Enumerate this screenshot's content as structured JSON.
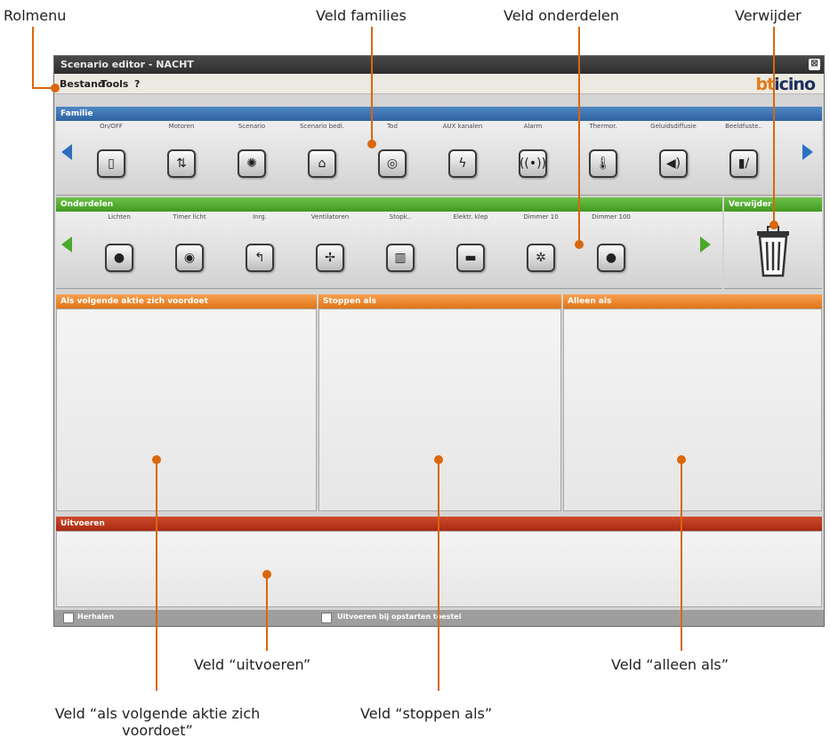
{
  "callouts": {
    "rolmenu": "Rolmenu",
    "veld_families": "Veld families",
    "veld_onderdelen": "Veld onderdelen",
    "verwijder": "Verwijder",
    "veld_uitvoeren": "Veld “uitvoeren”",
    "veld_alleen_als": "Veld “alleen als”",
    "veld_als_volgende": "Veld “als volgende aktie zich voordoet”",
    "veld_stoppen_als": "Veld “stoppen als”"
  },
  "window": {
    "title": "Scenario editor - NACHT",
    "close_glyph": "⊠"
  },
  "menu": {
    "items": [
      "Bestand",
      "Tools",
      "?"
    ]
  },
  "brand": {
    "logo_text": "bticino",
    "logo_accent": "#e07b1a",
    "logo_main": "#1e2f5e"
  },
  "familie": {
    "header": "Familie",
    "items": [
      {
        "label": "On/OFF",
        "icon": "light-switch-icon",
        "glyph": "▯"
      },
      {
        "label": "Motoren",
        "icon": "shutter-motor-icon",
        "glyph": "⇅"
      },
      {
        "label": "Scenario",
        "icon": "scenario-icon",
        "glyph": "✺"
      },
      {
        "label": "Scenario bedi.",
        "icon": "house-control-icon",
        "glyph": "⌂"
      },
      {
        "label": "Tod",
        "icon": "dimmer-dial-icon",
        "glyph": "◎"
      },
      {
        "label": "AUX kanalen",
        "icon": "lightning-icon",
        "glyph": "ϟ"
      },
      {
        "label": "Alarm",
        "icon": "alarm-signal-icon",
        "glyph": "((•))"
      },
      {
        "label": "Thermor.",
        "icon": "thermometer-icon",
        "glyph": "🌡"
      },
      {
        "label": "Geluidsdiffusie",
        "icon": "speaker-icon",
        "glyph": "◀)"
      },
      {
        "label": "Beeldfuste..",
        "icon": "intercom-icon",
        "glyph": "▮/"
      }
    ]
  },
  "onderdelen": {
    "header": "Onderdelen",
    "items": [
      {
        "label": "Lichten",
        "icon": "bulb-icon",
        "glyph": "●"
      },
      {
        "label": "Timer licht",
        "icon": "timer-light-icon",
        "glyph": "◉"
      },
      {
        "label": "Inrg.",
        "icon": "return-arrow-icon",
        "glyph": "↰"
      },
      {
        "label": "Ventilatoren",
        "icon": "fan-icon",
        "glyph": "✢"
      },
      {
        "label": "Stopk..",
        "icon": "socket-icon",
        "glyph": "▥"
      },
      {
        "label": "Elektr. klep",
        "icon": "valve-icon",
        "glyph": "▬"
      },
      {
        "label": "Dimmer 10",
        "icon": "dimmer-10-icon",
        "glyph": "✲"
      },
      {
        "label": "Dimmer 100",
        "icon": "dimmer-100-icon",
        "glyph": "●"
      }
    ]
  },
  "verwijder": {
    "header": "Verwijder",
    "icon": "trash-bin-icon"
  },
  "fields": {
    "als_volgende": "Als volgende aktie zich voordoet",
    "stoppen_als": "Stoppen als",
    "alleen_als": "Alleen als",
    "uitvoeren": "Uitvoeren"
  },
  "options": {
    "herhalen": "Herhalen",
    "uitvoeren_opstarten": "Uitvoeren bij opstarten toestel"
  },
  "colors": {
    "callout_orange": "#d9670d",
    "familie_blue": "#2e63a3",
    "onderdelen_green": "#3e9a20",
    "field_orange": "#e07519",
    "uitvoeren_red": "#a82a14"
  }
}
